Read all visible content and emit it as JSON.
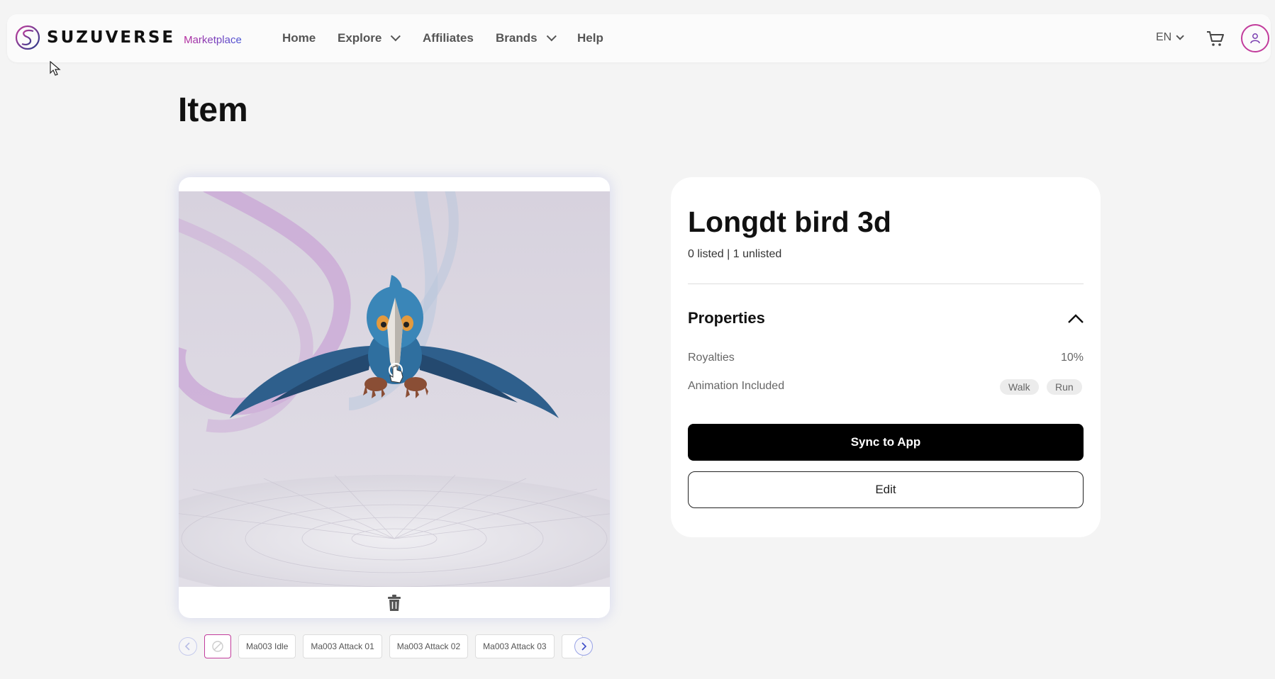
{
  "header": {
    "logo_text": "SUZUVERSE",
    "logo_sub": "Marketplace",
    "nav": [
      {
        "label": "Home"
      },
      {
        "label": "Explore"
      },
      {
        "label": "Affiliates"
      },
      {
        "label": "Brands"
      },
      {
        "label": "Help"
      }
    ],
    "language": "EN"
  },
  "page": {
    "title": "Item"
  },
  "animations": {
    "chips": [
      "Ma003 Idle",
      "Ma003 Attack 01",
      "Ma003 Attack 02",
      "Ma003 Attack 03"
    ]
  },
  "item": {
    "name": "Longdt bird 3d",
    "listing_status": "0 listed | 1 unlisted",
    "properties_title": "Properties",
    "properties": {
      "royalties_label": "Royalties",
      "royalties_value": "10%",
      "animation_label": "Animation Included",
      "animation_tags": [
        "Walk",
        "Run"
      ]
    },
    "sync_button": "Sync to App",
    "edit_button": "Edit"
  },
  "colors": {
    "brand_pink": "#c23c9c",
    "brand_blue": "#4854d6",
    "bird_blue": "#2f6f9f",
    "scene_bg": "#dcd7e4"
  }
}
